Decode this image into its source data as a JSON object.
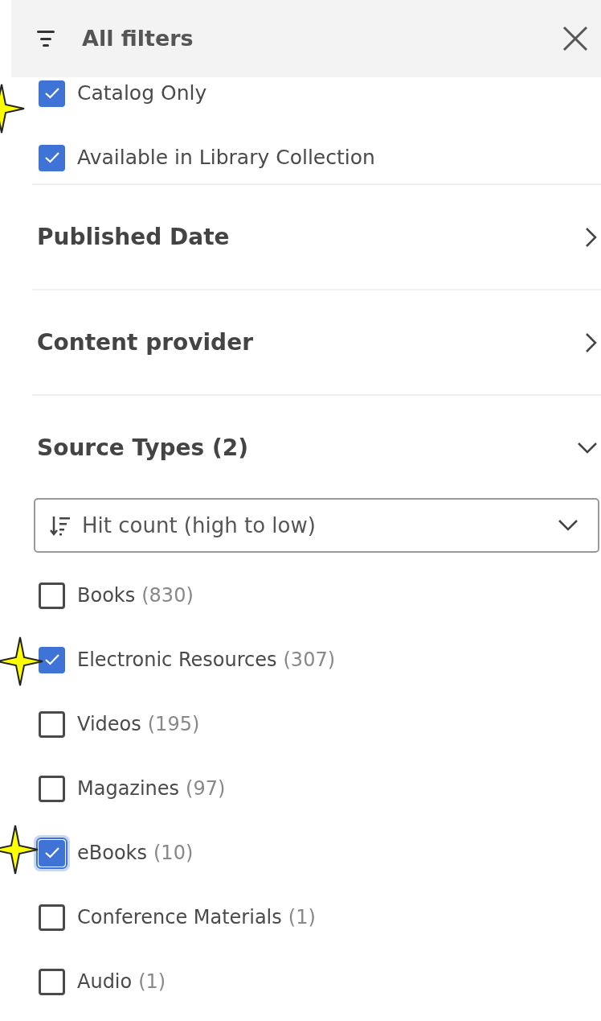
{
  "header": {
    "title": "All filters"
  },
  "top_options": [
    {
      "label": "Catalog Only",
      "checked": true
    },
    {
      "label": "Available in Library Collection",
      "checked": true
    }
  ],
  "sections": [
    {
      "title": "Published Date",
      "expanded": false
    },
    {
      "title": "Content provider",
      "expanded": false
    },
    {
      "title": "Source Types (2)",
      "expanded": true
    }
  ],
  "sort": {
    "value": "Hit count (high to low)"
  },
  "source_types": [
    {
      "label": "Books",
      "count": "(830)",
      "checked": false,
      "focused": false
    },
    {
      "label": "Electronic Resources",
      "count": "(307)",
      "checked": true,
      "focused": false
    },
    {
      "label": "Videos",
      "count": "(195)",
      "checked": false,
      "focused": false
    },
    {
      "label": "Magazines",
      "count": "(97)",
      "checked": false,
      "focused": false
    },
    {
      "label": "eBooks",
      "count": "(10)",
      "checked": true,
      "focused": true
    },
    {
      "label": "Conference Materials",
      "count": "(1)",
      "checked": false,
      "focused": false
    },
    {
      "label": "Audio",
      "count": "(1)",
      "checked": false,
      "focused": false
    }
  ]
}
